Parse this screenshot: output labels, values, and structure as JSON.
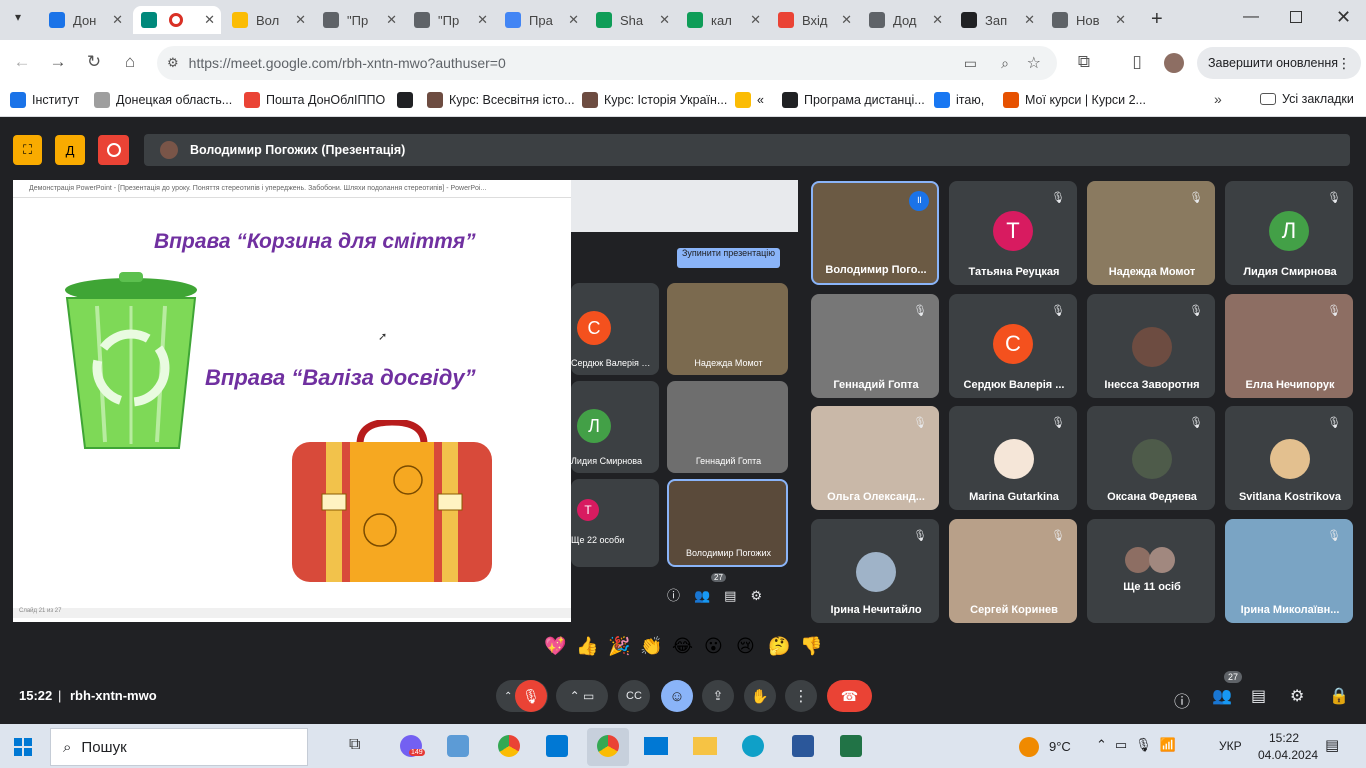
{
  "browser": {
    "tabs": [
      {
        "title": "Дон",
        "color": "#1a73e8",
        "icon": "docs-icon"
      },
      {
        "title": "",
        "color": "#00897b",
        "icon": "meet-icon"
      },
      {
        "title": "Вол",
        "color": "#fbbc04",
        "icon": "hand-icon"
      },
      {
        "title": "\"Пр",
        "color": "#5f6368",
        "icon": "loading-icon"
      },
      {
        "title": "\"Пр",
        "color": "#5f6368",
        "icon": "loading-icon"
      },
      {
        "title": "Пра",
        "color": "#4285f4",
        "icon": "doc-icon"
      },
      {
        "title": "Sha",
        "color": "#0f9d58",
        "icon": "drive-icon"
      },
      {
        "title": "кал",
        "color": "#0f9d58",
        "icon": "drive-icon"
      },
      {
        "title": "Вхід",
        "color": "#ea4335",
        "icon": "gmail-icon"
      },
      {
        "title": "Дод",
        "color": "#5f6368",
        "icon": "bank-icon"
      },
      {
        "title": "Зап",
        "color": "#202124",
        "icon": "wikipedia-icon"
      },
      {
        "title": "Нов",
        "color": "#5f6368",
        "icon": "chrome-icon"
      }
    ],
    "url": "https://meet.google.com/rbh-xntn-mwo?authuser=0",
    "update_label": "Завершити оновлення",
    "bookmarks": [
      "Інститут",
      "Донецкая область...",
      "Пошта ДонОблІППО",
      "",
      "Курс: Всесвітня істо...",
      "Курс: Історія Україн...",
      "«",
      "Програма дистанці...",
      "ітаю,",
      "Мої курси | Курси 2..."
    ],
    "all_bookmarks": "Усі закладки"
  },
  "meet": {
    "presenter_label": "Володимир Погожих (Презентація)",
    "slide": {
      "window_title": "Демонстрація PowerPoint - [Презентація до уроку. Поняття стереотипів і упереджень. Забобони. Шляхи подолання стереотипів] - PowerPoi...",
      "heading1": "Вправа “Корзина для сміття”",
      "heading2": "Вправа “Валіза досвіду”",
      "status": "Слайд 21 из 27"
    },
    "inner": {
      "stop_label": "Зупинити презентацію",
      "names": [
        "Сердюк Валерія Ге...",
        "Надежда Момот",
        "Лидия Смирнова",
        "Геннадий Гопта",
        "Ще 22 особи",
        "Володимир Погожих"
      ],
      "count": "27"
    },
    "participants": [
      "Володимир Пого...",
      "Татьяна Реуцкая",
      "Надежда Момот",
      "Лидия Смирнова",
      "Геннадий Гопта",
      "Сердюк Валерія ...",
      "Інесса Заворотня",
      "Елла Нечипорук",
      "Ольга Олександ...",
      "Marina Gutarkina",
      "Оксана Федяева",
      "Svitlana Kostrikova",
      "Ірина Нечитайло",
      "Сергей Коринев",
      "Ще 11 осіб",
      "Ірина Миколаївн..."
    ],
    "reactions": [
      "💖",
      "👍",
      "🎉",
      "👏",
      "😂",
      "😮",
      "😢",
      "🤔",
      "👎"
    ],
    "time": "15:22",
    "code": "rbh-xntn-mwo",
    "people_count": "27"
  },
  "taskbar": {
    "search": "Пошук",
    "weather": "9°C",
    "lang": "УКР",
    "time": "15:22",
    "date": "04.04.2024",
    "badge": "149"
  }
}
